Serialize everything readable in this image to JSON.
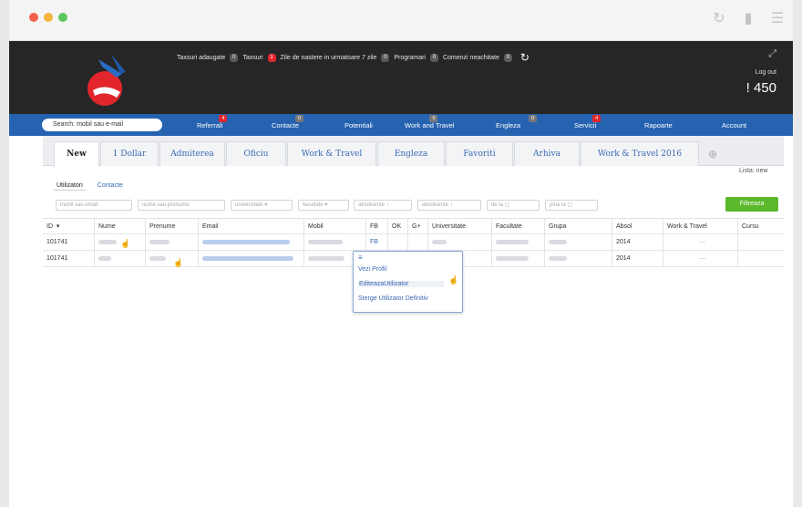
{
  "colors": {
    "header_bg": "#262626",
    "nav_bg": "#2562b0",
    "accent": "#3a6ab5",
    "badge_red": "#e2262c",
    "filter_btn": "#5cb82c"
  },
  "topbar": {
    "icons": [
      "reload-icon",
      "bookmark-icon",
      "menu-icon"
    ]
  },
  "header": {
    "notifications": [
      {
        "label": "Taxsuri adaugate",
        "count": "0",
        "red": false
      },
      {
        "label": "Taxsuri",
        "count": "1",
        "red": true
      },
      {
        "label": "Zile de nastere in urmatoare 7 zile",
        "count": "0",
        "red": false
      },
      {
        "label": "Programari",
        "count": "0",
        "red": false
      },
      {
        "label": "Comenzi neachitate",
        "count": "0",
        "red": false
      }
    ],
    "logout": "Log out",
    "count": "450"
  },
  "nav": {
    "search_placeholder": "Search: mobil sau e-mail",
    "items": [
      {
        "label": "Referrali",
        "badge": "4",
        "red": true
      },
      {
        "label": "Contacte",
        "badge": "0",
        "red": false
      },
      {
        "label": "Potentiali",
        "badge": "",
        "red": false
      },
      {
        "label": "Work and Travel",
        "badge": "0",
        "red": false
      },
      {
        "label": "Engleza",
        "badge": "0",
        "red": false
      },
      {
        "label": "Servicii",
        "badge": "4",
        "red": true
      },
      {
        "label": "Rapoarte",
        "badge": "",
        "red": false
      },
      {
        "label": "Account",
        "badge": "",
        "red": false
      }
    ]
  },
  "tabs": [
    "New",
    "1 Dollar",
    "Admiterea",
    "Oficiu",
    "Work & Travel",
    "Engleza",
    "Favoriti",
    "Arhiva",
    "Work & Travel 2016"
  ],
  "lista": "Lista: new",
  "subtabs": [
    "Utilizatori",
    "Contacte"
  ],
  "filters": [
    "mobil sau email",
    "nume sau prenume",
    "universitate",
    "facultate",
    "absolvente",
    "absolvente",
    "de la",
    "pina la"
  ],
  "filter_button": "Filtreaza",
  "table": {
    "columns": [
      "ID",
      "Nume",
      "Prenume",
      "Email",
      "Mobil",
      "FB",
      "OK",
      "G+",
      "Universitate",
      "Facultate",
      "Grupa",
      "Absol",
      "Work & Travel",
      "Cursu"
    ],
    "rows": [
      {
        "id": "101741",
        "fb": "FB",
        "univ": "",
        "absol": "2014",
        "wt": "—"
      },
      {
        "id": "101741",
        "fb": "",
        "univ": "M",
        "absol": "2014",
        "wt": "—"
      }
    ]
  },
  "context_menu": [
    "Vezi Profil",
    "EditeazaUtilizator",
    "Sterge Utilizator Definitiv"
  ]
}
